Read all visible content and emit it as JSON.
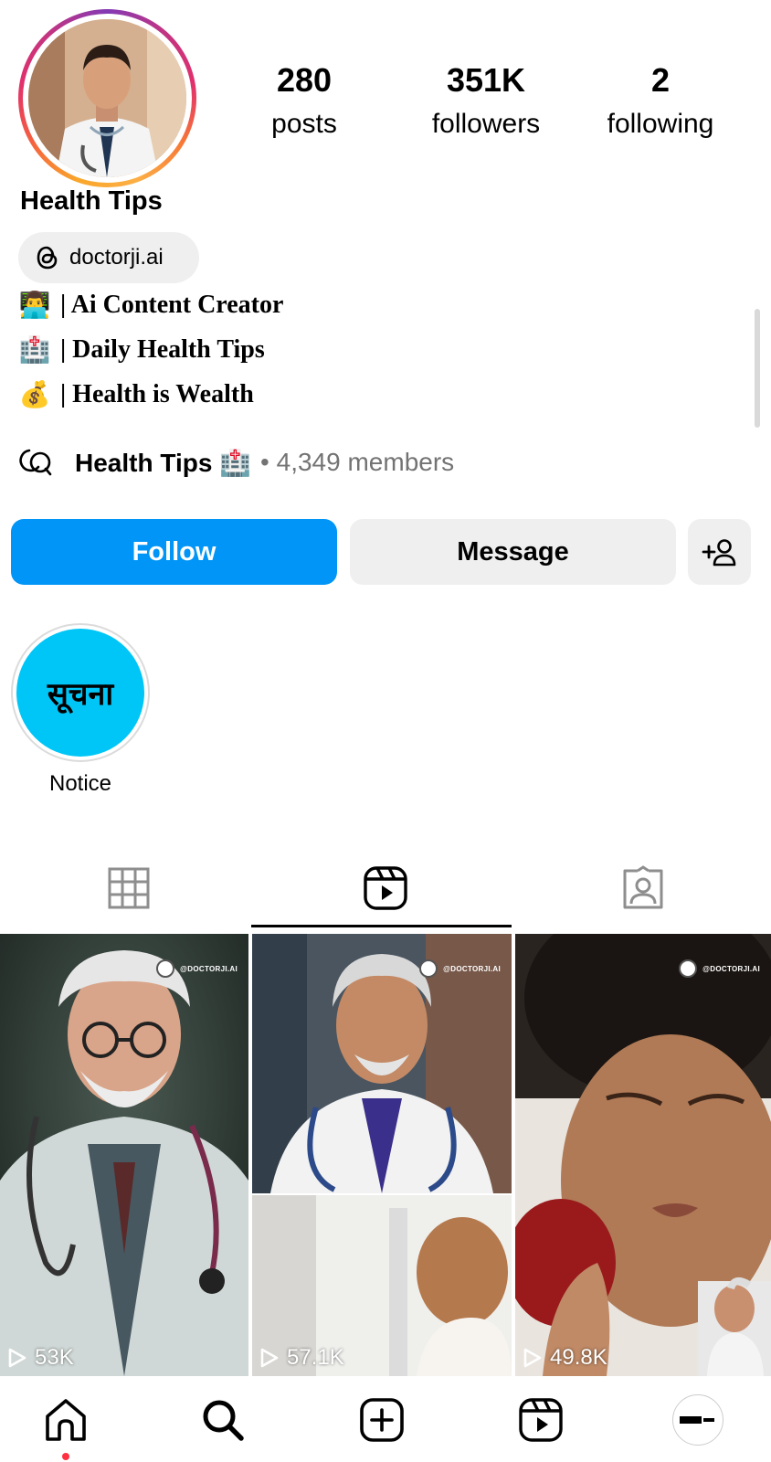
{
  "profile": {
    "name": "Health Tips",
    "stats": [
      {
        "value": "280",
        "label": "posts"
      },
      {
        "value": "351K",
        "label": "followers"
      },
      {
        "value": "2",
        "label": "following"
      }
    ],
    "threads_handle": "doctorji.ai",
    "bio": [
      {
        "emoji": "👨‍💻",
        "text": "| Ai Content Creator"
      },
      {
        "emoji": "🏥",
        "text": "| Daily Health Tips"
      },
      {
        "emoji": "💰",
        "text": "| Health is Wealth"
      }
    ],
    "channel": {
      "name": "Health Tips 🏥",
      "members": "• 4,349 members"
    }
  },
  "actions": {
    "follow": "Follow",
    "message": "Message"
  },
  "highlights": [
    {
      "title": "सूचना",
      "label": "Notice",
      "color": "#00c6f7"
    }
  ],
  "tabs": [
    {
      "icon": "grid-icon",
      "active": false
    },
    {
      "icon": "reels-icon",
      "active": true
    },
    {
      "icon": "tagged-icon",
      "active": false
    }
  ],
  "reels": [
    {
      "views": "53K",
      "watermark": "@DOCTORJI.AI"
    },
    {
      "views": "57.1K",
      "watermark": "@DOCTORJI.AI"
    },
    {
      "views": "49.8K",
      "watermark": "@DOCTORJI.AI"
    }
  ],
  "bottom_nav": [
    {
      "icon": "home-icon"
    },
    {
      "icon": "search-icon"
    },
    {
      "icon": "create-icon"
    },
    {
      "icon": "reels-icon"
    },
    {
      "icon": "profile-avatar"
    }
  ],
  "colors": {
    "follow_blue": "#0095f6",
    "chip_gray": "#efefef",
    "highlight_cyan": "#00c6f7",
    "notification_red": "#ff3040"
  }
}
